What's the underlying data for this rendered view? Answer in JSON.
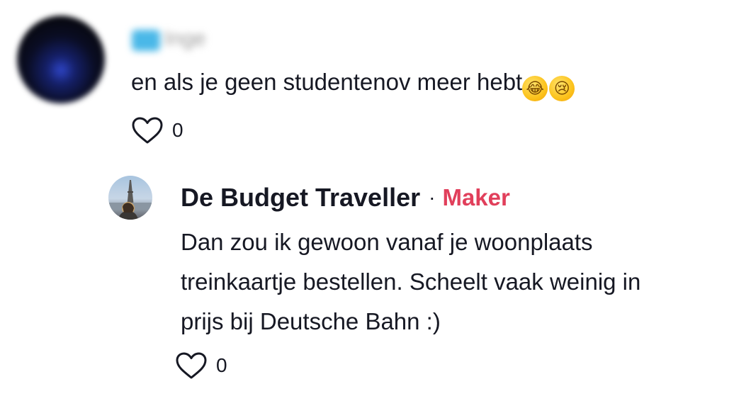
{
  "parent_comment": {
    "author_name": "Inge",
    "text": "en als je geen studentenov meer hebt",
    "emojis": [
      {
        "icon": "face-with-tears-of-joy",
        "glyph": "😂"
      },
      {
        "icon": "crying-face",
        "glyph": "😢"
      }
    ],
    "like_icon": "heart-outline",
    "like_count": "0"
  },
  "reply": {
    "author_name": "De Budget Traveller",
    "separator": "·",
    "creator_tag": "Maker",
    "text_lines": [
      "Dan zou ik gewoon vanaf je woonplaats",
      "treinkaartje bestellen. Scheelt vaak weinig in",
      "prijs bij Deutsche Bahn :)"
    ],
    "like_icon": "heart-outline",
    "like_count": "0"
  },
  "colors": {
    "text": "#161823",
    "creator_tag": "#e13f5b",
    "background": "#ffffff"
  }
}
